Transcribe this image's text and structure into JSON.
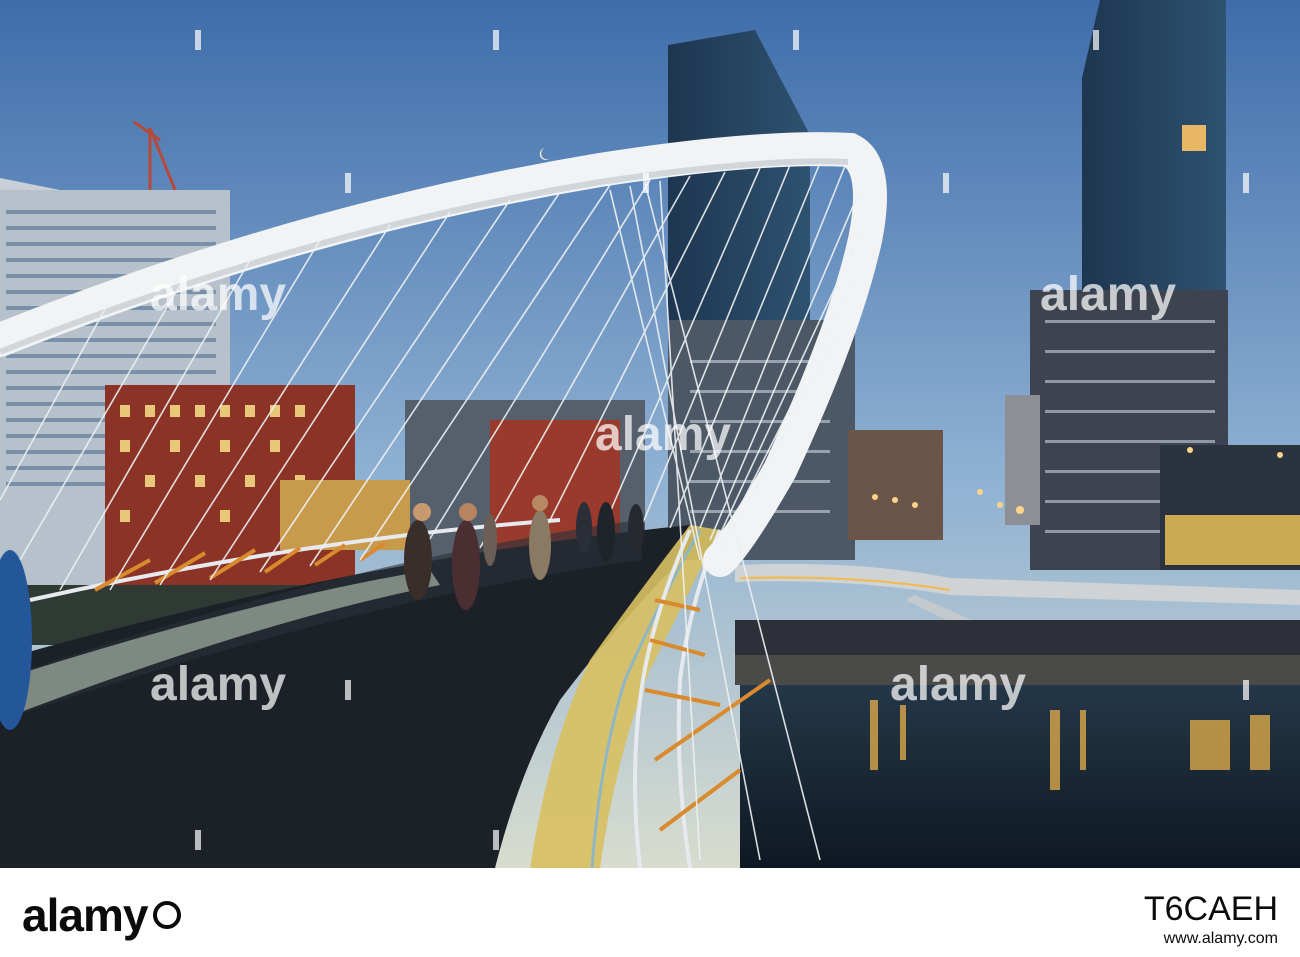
{
  "photo": {
    "description_icons": [
      "crescent-moon-icon"
    ],
    "colors": {
      "sky_top": "#3f6fae",
      "sky_bottom": "#bcd0df",
      "water": "#1a2a3a",
      "light": "#f5b94a",
      "deck": "#1d2228"
    }
  },
  "watermark": {
    "text": "alamy",
    "ticks": [
      "a",
      "a",
      "a",
      "a",
      "a",
      "a"
    ]
  },
  "footer": {
    "logo_text": "alamy",
    "stock_id": "T6CAEH",
    "stock_url": "www.alamy.com"
  }
}
